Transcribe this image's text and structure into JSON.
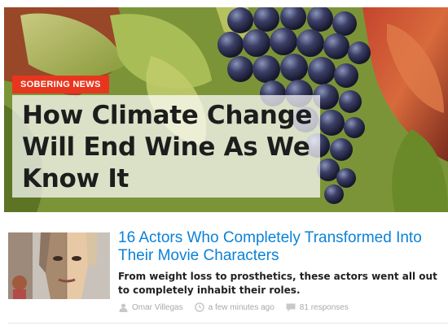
{
  "hero": {
    "badge": "SOBERING NEWS",
    "headline": "How Climate Change Will End Wine As We Know It"
  },
  "article": {
    "title": "16 Actors Who Completely Transformed Into Their Movie Characters",
    "description": "From weight loss to prosthetics, these actors went all out to completely inhabit their roles.",
    "author": "Omar Villegas",
    "time": "a few minutes ago",
    "responses": "81 responses"
  },
  "icons": {
    "author": "user-icon",
    "time": "clock-icon",
    "responses": "speech-bubble-icon"
  },
  "colors": {
    "badge": "#e8361e",
    "link": "#0b82d8",
    "meta": "#a9a9a9"
  }
}
